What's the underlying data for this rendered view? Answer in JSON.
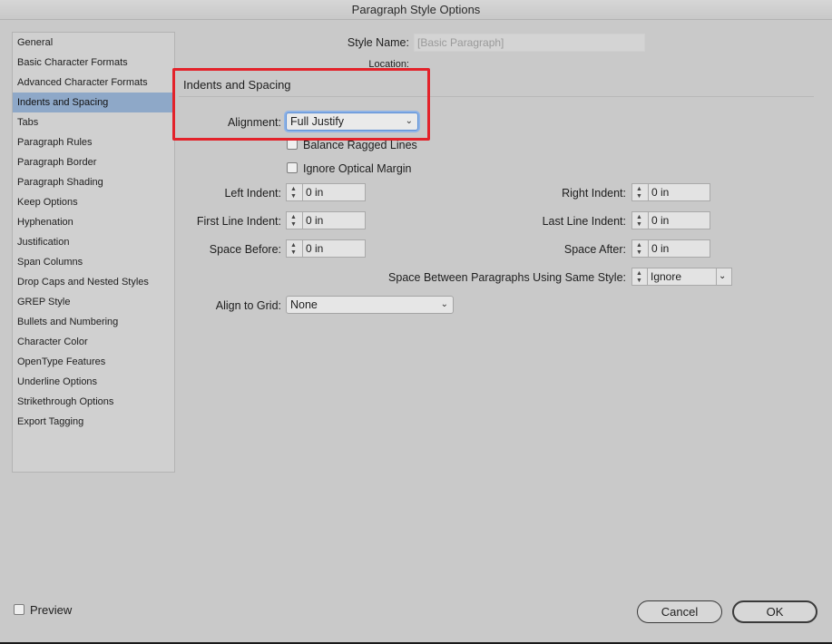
{
  "window": {
    "title": "Paragraph Style Options"
  },
  "sidebar": {
    "items": [
      {
        "label": "General"
      },
      {
        "label": "Basic Character Formats"
      },
      {
        "label": "Advanced Character Formats"
      },
      {
        "label": "Indents and Spacing",
        "selected": true
      },
      {
        "label": "Tabs"
      },
      {
        "label": "Paragraph Rules"
      },
      {
        "label": "Paragraph Border"
      },
      {
        "label": "Paragraph Shading"
      },
      {
        "label": "Keep Options"
      },
      {
        "label": "Hyphenation"
      },
      {
        "label": "Justification"
      },
      {
        "label": "Span Columns"
      },
      {
        "label": "Drop Caps and Nested Styles"
      },
      {
        "label": "GREP Style"
      },
      {
        "label": "Bullets and Numbering"
      },
      {
        "label": "Character Color"
      },
      {
        "label": "OpenType Features"
      },
      {
        "label": "Underline Options"
      },
      {
        "label": "Strikethrough Options"
      },
      {
        "label": "Export Tagging"
      }
    ]
  },
  "header": {
    "style_name_label": "Style Name:",
    "style_name_value": "[Basic Paragraph]",
    "location_label": "Location:"
  },
  "section": {
    "title": "Indents and Spacing"
  },
  "alignment": {
    "label": "Alignment:",
    "value": "Full Justify"
  },
  "checkboxes": {
    "balance_ragged_lines": {
      "label": "Balance Ragged Lines",
      "checked": false
    },
    "ignore_optical_margin": {
      "label": "Ignore Optical Margin",
      "checked": false
    }
  },
  "indents": {
    "left_indent": {
      "label": "Left Indent:",
      "value": "0 in"
    },
    "right_indent": {
      "label": "Right Indent:",
      "value": "0 in"
    },
    "first_line_indent": {
      "label": "First Line Indent:",
      "value": "0 in"
    },
    "last_line_indent": {
      "label": "Last Line Indent:",
      "value": "0 in"
    },
    "space_before": {
      "label": "Space Before:",
      "value": "0 in"
    },
    "space_after": {
      "label": "Space After:",
      "value": "0 in"
    }
  },
  "space_between": {
    "label": "Space Between Paragraphs Using Same Style:",
    "value": "Ignore"
  },
  "align_to_grid": {
    "label": "Align to Grid:",
    "value": "None"
  },
  "footer": {
    "preview_label": "Preview",
    "preview_checked": false,
    "cancel_label": "Cancel",
    "ok_label": "OK"
  },
  "colors": {
    "highlight": "#e3222a",
    "selection": "#8ea8c8",
    "focus_ring": "#5b8fd6"
  }
}
